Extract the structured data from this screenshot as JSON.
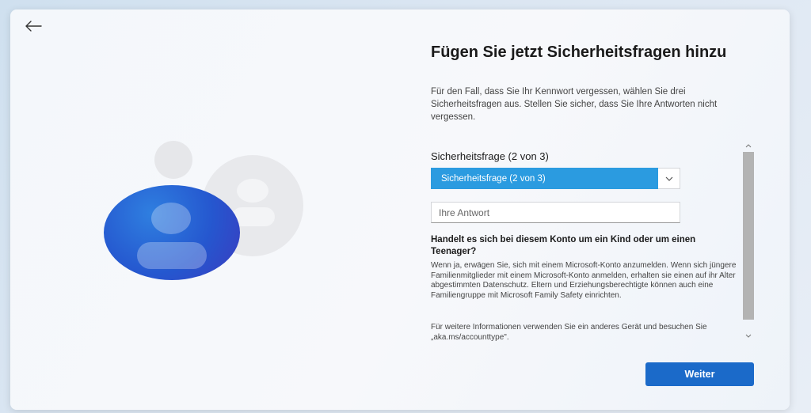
{
  "header": {
    "back_icon": "arrow-left-icon"
  },
  "page": {
    "title": "Fügen Sie jetzt Sicherheitsfragen hinzu",
    "description": "Für den Fall, dass Sie Ihr Kennwort vergessen, wählen Sie drei Sicherheitsfragen aus. Stellen Sie sicher, dass Sie Ihre Antworten nicht vergessen."
  },
  "form": {
    "question_label": "Sicherheitsfrage (2 von 3)",
    "question_selected": "Sicherheitsfrage (2 von 3)",
    "answer_placeholder": "Ihre Antwort",
    "answer_value": ""
  },
  "info": {
    "title": "Handelt es sich bei diesem Konto um ein Kind oder um einen Teenager?",
    "body": "Wenn ja, erwägen Sie, sich mit einem Microsoft-Konto anzumelden. Wenn sich jüngere Familienmitglieder mit einem Microsoft-Konto anmelden, erhalten sie einen auf ihr Alter abgestimmten Datenschutz. Eltern und Erziehungsberechtigte können auch eine Familiengruppe mit Microsoft Family Safety einrichten.",
    "more": "Für weitere Informationen verwenden Sie ein anderes Gerät und besuchen Sie „aka.ms/accounttype\"."
  },
  "footer": {
    "next_label": "Weiter"
  },
  "colors": {
    "accent": "#1b6ac9",
    "select_highlight": "#2b9be0"
  }
}
